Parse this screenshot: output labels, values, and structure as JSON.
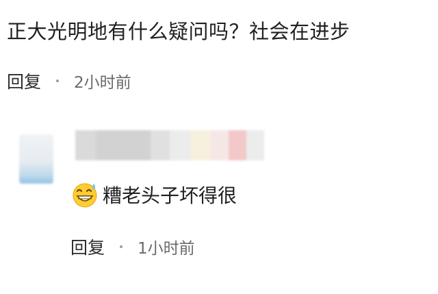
{
  "comment": {
    "text": "正大光明地有什么疑问吗？社会在进步",
    "reply_label": "回复",
    "time": "2小时前"
  },
  "reply": {
    "emoji_icon": "grinning-sweat-emoji-icon",
    "text": "糟老头子坏得很",
    "reply_label": "回复",
    "time": "1小时前"
  }
}
